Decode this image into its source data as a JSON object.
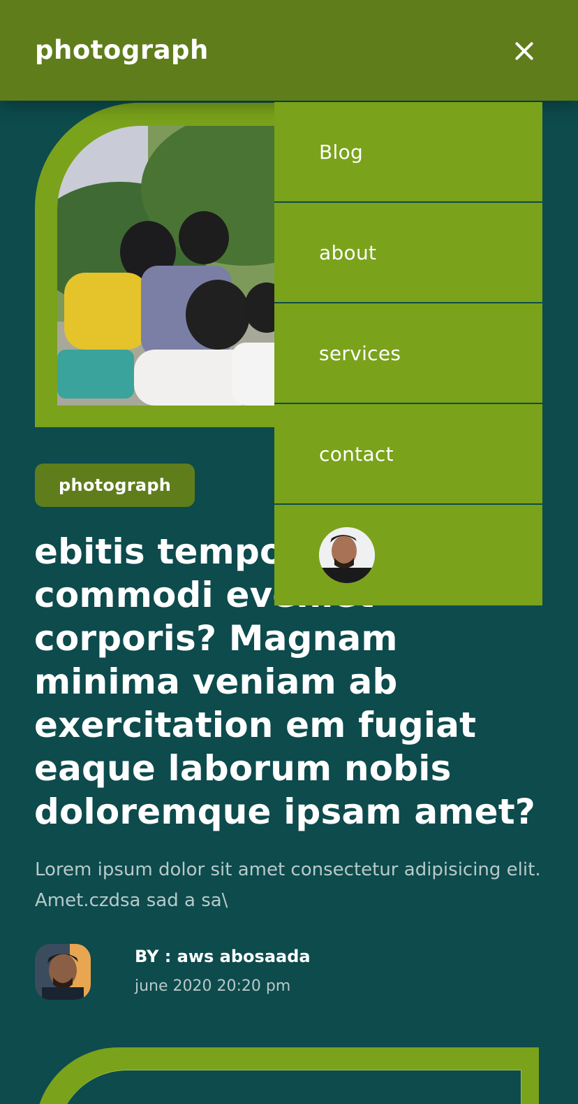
{
  "header": {
    "brand": "photograph",
    "close_icon": "close-icon"
  },
  "menu": {
    "items": [
      {
        "label": "Blog"
      },
      {
        "label": "about"
      },
      {
        "label": "services"
      },
      {
        "label": "contact"
      }
    ],
    "avatar_icon": "user-avatar"
  },
  "post": {
    "category": "photograph",
    "title": "ebitis tempo incidunt commodi eveniet corporis? Magnam minima veniam ab exercitation em fugiat eaque laborum nobis doloremque ipsam amet?",
    "excerpt": "Lorem ipsum dolor sit amet consectetur adipisicing elit. Amet.czdsa sad a sa\\",
    "author": "BY : aws abosaada",
    "date": "june 2020 20:20 pm"
  },
  "colors": {
    "background": "#0d4b4d",
    "header": "#5f7d1b",
    "accent": "#7aa21b",
    "muted_text": "#b9c9c9"
  }
}
